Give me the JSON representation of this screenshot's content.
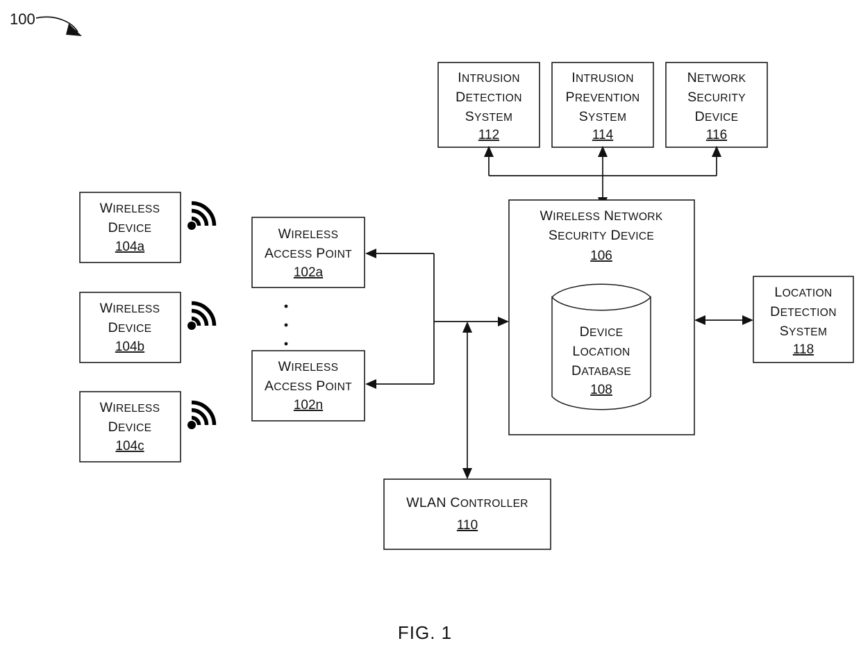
{
  "figure": {
    "number_label": "100",
    "caption": "FIG. 1"
  },
  "nodes": {
    "intrusion_detection_system": {
      "lines": [
        "Intrusion",
        "Detection",
        "System"
      ],
      "ref": "112"
    },
    "intrusion_prevention_system": {
      "lines": [
        "Intrusion",
        "Prevention",
        "System"
      ],
      "ref": "114"
    },
    "network_security_device": {
      "lines": [
        "Network",
        "Security",
        "Device"
      ],
      "ref": "116"
    },
    "wireless_device_a": {
      "lines": [
        "Wireless",
        "Device"
      ],
      "ref": "104a",
      "icon": "wifi-signal-icon"
    },
    "wireless_device_b": {
      "lines": [
        "Wireless",
        "Device"
      ],
      "ref": "104b",
      "icon": "wifi-signal-icon"
    },
    "wireless_device_c": {
      "lines": [
        "Wireless",
        "Device"
      ],
      "ref": "104c",
      "icon": "wifi-signal-icon"
    },
    "wireless_access_point_a": {
      "lines": [
        "Wireless",
        "Access Point"
      ],
      "ref": "102a"
    },
    "wireless_access_point_n": {
      "lines": [
        "Wireless",
        "Access Point"
      ],
      "ref": "102n"
    },
    "wireless_network_security_device": {
      "lines": [
        "Wireless Network",
        "Security Device"
      ],
      "ref": "106"
    },
    "device_location_database": {
      "lines": [
        "Device",
        "Location",
        "Database"
      ],
      "ref": "108",
      "shape": "cylinder"
    },
    "location_detection_system": {
      "lines": [
        "Location",
        "Detection",
        "System"
      ],
      "ref": "118"
    },
    "wlan_controller": {
      "lines": [
        "WLAN Controller"
      ],
      "ref": "110"
    }
  },
  "ellipsis": {
    "symbol": "vertical-ellipsis",
    "between": [
      "wireless_access_point_a",
      "wireless_access_point_n"
    ]
  },
  "colors": {
    "stroke": "#111111",
    "fill": "#ffffff",
    "background": "#ffffff"
  }
}
